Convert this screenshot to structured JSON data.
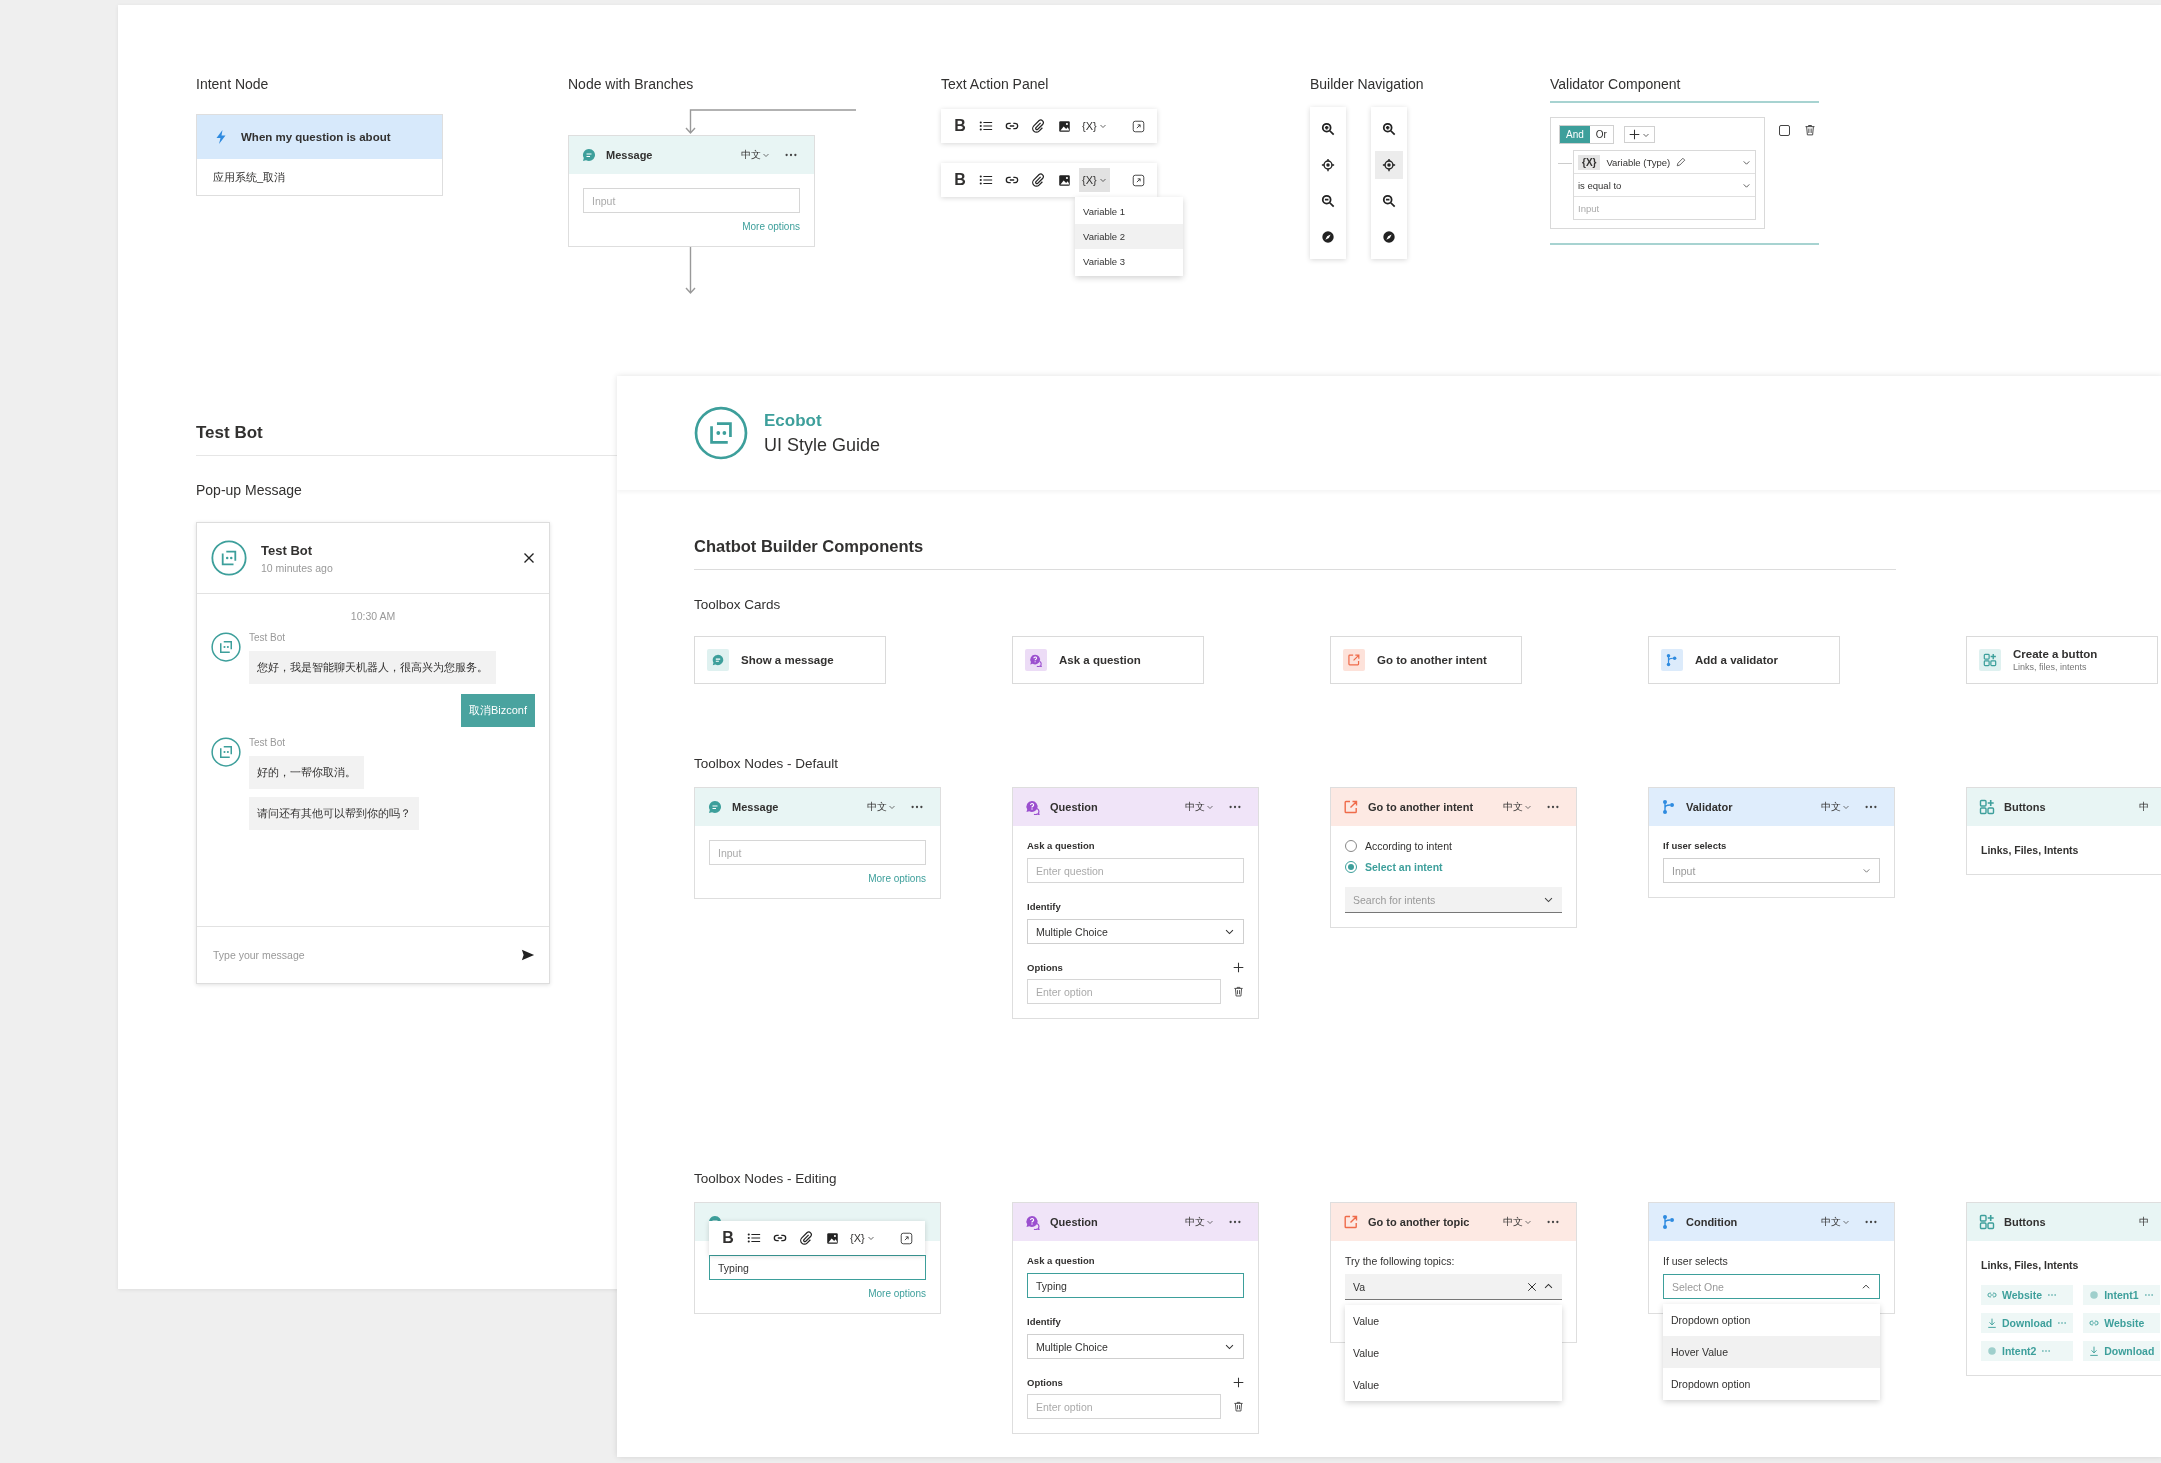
{
  "intent_node": {
    "heading": "Intent Node",
    "title": "When my question is about",
    "value": "应用系统_取消"
  },
  "branch_node": {
    "heading": "Node with Branches",
    "node": {
      "kind": "message",
      "title": "Message",
      "lang": "中文",
      "menu": true,
      "placeholder": "Input",
      "link": "More options"
    }
  },
  "text_action_panel": {
    "heading": "Text Action Panel",
    "toolbars": [
      {
        "bold": "B",
        "variable": "{X}",
        "open": false
      },
      {
        "bold": "B",
        "variable": "{X}",
        "open": true,
        "menu": [
          {
            "label": "Variable 1",
            "selected": false
          },
          {
            "label": "Variable 2",
            "selected": true
          },
          {
            "label": "Variable 3",
            "selected": false
          }
        ]
      }
    ]
  },
  "builder_navigation": {
    "heading": "Builder Navigation",
    "panels": [
      {
        "tools": [
          {
            "kind": "zoom-in",
            "selected": false
          },
          {
            "kind": "target",
            "selected": false
          },
          {
            "kind": "zoom-out",
            "selected": false
          },
          {
            "kind": "compass",
            "selected": false
          }
        ]
      },
      {
        "tools": [
          {
            "kind": "zoom-in",
            "selected": false
          },
          {
            "kind": "target",
            "selected": true
          },
          {
            "kind": "zoom-out",
            "selected": false
          },
          {
            "kind": "compass",
            "selected": false
          }
        ]
      }
    ]
  },
  "validator": {
    "heading": "Validator Component",
    "logic": [
      {
        "label": "And",
        "selected": true
      },
      {
        "label": "Or",
        "selected": false
      }
    ],
    "variable_tag": "{X}",
    "variable": "Variable (Type)",
    "operator": "is equal to",
    "placeholder": "Input",
    "checked": false
  },
  "test_bot": {
    "heading": "Test Bot",
    "subheading": "Pop-up Message",
    "chat": {
      "name": "Test Bot",
      "time_ago": "10 minutes ago",
      "timestamp": "10:30 AM",
      "placeholder": "Type your message",
      "messages": [
        {
          "kind": "bot",
          "sender": "Test Bot",
          "bubbles": [
            "您好，我是智能聊天机器人，很高兴为您服务。"
          ]
        },
        {
          "kind": "user",
          "bubbles": [
            "取消Bizconf"
          ]
        },
        {
          "kind": "bot",
          "sender": "Test Bot",
          "bubbles": [
            "好的，一帮你取消。",
            "请问还有其他可以帮到你的吗？"
          ]
        }
      ]
    }
  },
  "guide": {
    "brand": "Ecobot",
    "title": "UI Style Guide",
    "section": "Chatbot Builder Components",
    "toolbox_cards": {
      "heading": "Toolbox Cards",
      "cards": [
        {
          "kind": "message",
          "label": "Show a message"
        },
        {
          "kind": "question",
          "label": "Ask a question"
        },
        {
          "kind": "intent",
          "label": "Go to another intent"
        },
        {
          "kind": "validator",
          "label": "Add a validator"
        },
        {
          "kind": "buttons",
          "label": "Create a button",
          "sublabel": "Links, files, intents"
        }
      ]
    },
    "default_nodes": {
      "heading": "Toolbox Nodes - Default",
      "nodes": [
        {
          "kind": "message",
          "title": "Message",
          "lang": "中文",
          "menu": true,
          "placeholder": "Input",
          "link": "More options"
        },
        {
          "kind": "question",
          "title": "Question",
          "lang": "中文",
          "menu": true,
          "question_label": "Ask a question",
          "question_placeholder": "Enter question",
          "focused": false,
          "identify_label": "Identify",
          "identify_value": "Multiple Choice",
          "options_label": "Options",
          "option_placeholder": "Enter option"
        },
        {
          "kind": "intent",
          "title": "Go to another intent",
          "lang": "中文",
          "menu": true,
          "choices": [
            {
              "label": "According to intent",
              "selected": false
            },
            {
              "label": "Select an intent",
              "selected": true
            }
          ],
          "search_placeholder": "Search for intents"
        },
        {
          "kind": "validator",
          "title": "Validator",
          "lang": "中文",
          "menu": true,
          "field_label": "If user selects",
          "placeholder": "Input"
        },
        {
          "kind": "buttons",
          "title": "Buttons",
          "lang": "中",
          "menu": false,
          "text": "Links, Files, Intents"
        }
      ]
    },
    "editing_nodes": {
      "heading": "Toolbox Nodes - Editing",
      "nodes": [
        {
          "kind": "message",
          "toolbar": {
            "bold": "B",
            "variable": "{X}",
            "open": false
          },
          "value": "Typing",
          "focused": true,
          "link": "More options"
        },
        {
          "kind": "question",
          "title": "Question",
          "lang": "中文",
          "menu": true,
          "question_label": "Ask a question",
          "question_value": "Typing",
          "focused": true,
          "identify_label": "Identify",
          "identify_value": "Multiple Choice",
          "options_label": "Options",
          "option_placeholder": "Enter option"
        },
        {
          "kind": "topic",
          "title": "Go to another topic",
          "lang": "中文",
          "menu": true,
          "field_label": "Try the following topics:",
          "value": "Va",
          "results": [
            "Value",
            "Value",
            "Value"
          ]
        },
        {
          "kind": "condition",
          "title": "Condition",
          "lang": "中文",
          "menu": true,
          "field_label": "If user selects",
          "placeholder": "Select One",
          "options": [
            {
              "label": "Dropdown option",
              "selected": false
            },
            {
              "label": "Hover Value",
              "selected": true
            },
            {
              "label": "Dropdown option",
              "selected": false
            }
          ]
        },
        {
          "kind": "buttons",
          "title": "Buttons",
          "lang": "中",
          "menu": false,
          "text": "Links, Files, Intents",
          "chips": [
            {
              "kind": "link",
              "label": "Website",
              "more": true
            },
            {
              "kind": "intent",
              "label": "Intent1",
              "more": true
            },
            {
              "kind": "download",
              "label": "Download",
              "more": true
            },
            {
              "kind": "link",
              "label": "Website",
              "more": false
            },
            {
              "kind": "intent",
              "label": "Intent2",
              "more": true
            },
            {
              "kind": "download",
              "label": "Download",
              "more": false
            }
          ]
        }
      ]
    }
  }
}
